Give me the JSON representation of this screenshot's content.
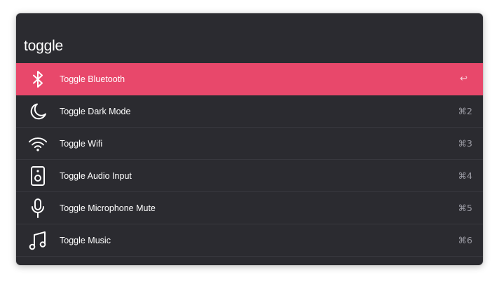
{
  "search": {
    "value": "toggle"
  },
  "results": [
    {
      "label": "Toggle Bluetooth",
      "shortcut": "↩",
      "icon": "bluetooth-icon",
      "selected": true
    },
    {
      "label": "Toggle Dark Mode",
      "shortcut": "⌘2",
      "icon": "moon-icon",
      "selected": false
    },
    {
      "label": "Toggle Wifi",
      "shortcut": "⌘3",
      "icon": "wifi-icon",
      "selected": false
    },
    {
      "label": "Toggle Audio Input",
      "shortcut": "⌘4",
      "icon": "speaker-icon",
      "selected": false
    },
    {
      "label": "Toggle Microphone Mute",
      "shortcut": "⌘5",
      "icon": "microphone-icon",
      "selected": false
    },
    {
      "label": "Toggle Music",
      "shortcut": "⌘6",
      "icon": "music-note-icon",
      "selected": false
    }
  ],
  "colors": {
    "panel_background": "#2b2b30",
    "selected_row": "#e8486b",
    "text": "#ffffff",
    "shortcut_text": "#9a9aa2"
  }
}
